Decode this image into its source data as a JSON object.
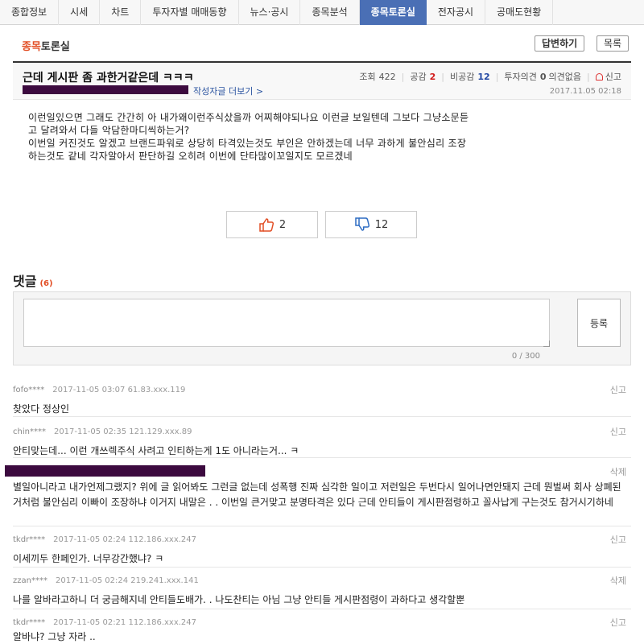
{
  "nav": {
    "tabs": [
      {
        "label": "종합정보"
      },
      {
        "label": "시세"
      },
      {
        "label": "차트"
      },
      {
        "label": "투자자별 매매동향"
      },
      {
        "label": "뉴스·공시"
      },
      {
        "label": "종목분석"
      },
      {
        "label": "종목토론실",
        "active": true
      },
      {
        "label": "전자공시"
      },
      {
        "label": "공매도현황"
      }
    ]
  },
  "board": {
    "title_accent": "종목",
    "title_rest": "토론실",
    "reply_label": "답변하기",
    "list_label": "목록"
  },
  "post": {
    "title": "근데 게시판 좀 과한거같은데 ㅋㅋㅋ",
    "views_label": "조회",
    "views": "422",
    "likes_label": "공감",
    "likes": "2",
    "dislikes_label": "비공감",
    "dislikes": "12",
    "opinion_label": "투자의견",
    "opinion_value": "0",
    "opinion_text": "의견없음",
    "report_label": "신고",
    "author_more": "작성자글 더보기 >",
    "date": "2017.11.05 02:18",
    "body": [
      "이런일있으면 그래도 간간히 아 내가왜이런주식샀을까 어찌해야되나요 이런글 보일텐데 그보다 그냥소문듣",
      "고 달려와서 다들 악담한마디씩하는거?",
      "이번일 커진것도 알겠고 브랜드파워로 상당히 타격있는것도 부인은 안하겠는데 너무 과하게 불안심리 조장",
      "하는것도 같네 각자알아서 판단하길 오히려 이번에 단타많이꼬일지도 모르겠네"
    ]
  },
  "votes": {
    "up": "2",
    "down": "12"
  },
  "comments_section": {
    "title": "댓글",
    "count": "(6)",
    "submit_label": "등록",
    "char_count": "0 / 300"
  },
  "comments": [
    {
      "nick": "fofo****",
      "meta": "2017-11-05 03:07 61.83.xxx.119",
      "action": "신고",
      "text": "찾았다 정상인"
    },
    {
      "nick": "chin****",
      "meta": "2017-11-05 02:35 121.129.xxx.89",
      "action": "신고",
      "text": "안티맞는데... 이런 개쓰렉주식 사려고 인티하는게 1도 아니라는거... ㅋ"
    },
    {
      "nick": "",
      "meta": "",
      "action": "삭제",
      "text": "별일아니라고 내가언제그랬지? 위에 글 읽어봐도 그런글 없는데 성폭행 진짜 심각한 일이고 저런일은 두번다시 일어나면안돼지 근데 뭔벌써 회사 상폐된거처럼 불안심리 이빠이 조장하냐 이거지 내말은 . . 이번일 큰거맞고 분명타격은 있다 근데 안티들이 게시판점령하고 꼴사납게 구는것도 참거시기하네"
    },
    {
      "nick": "tkdr****",
      "meta": "2017-11-05 02:24 112.186.xxx.247",
      "action": "신고",
      "text": "이세끼두 한페인가. 너무강간했냐? ㅋ"
    },
    {
      "nick": "zzan****",
      "meta": "2017-11-05 02:24 219.241.xxx.141",
      "action": "삭제",
      "text": "나를 알바라고하니 더 궁금해지네 안티들도배가. . 나도찬티는 아님 그냥 안티들 게시판점령이 과하다고 생각할뿐"
    },
    {
      "nick": "tkdr****",
      "meta": "2017-11-05 02:21 112.186.xxx.247",
      "action": "신고",
      "text": "알바냐? 그냥 자라 .."
    }
  ],
  "colors": {
    "accent": "#e24e25",
    "active_tab": "#4a6fb5",
    "redaction": "#3c0a3f"
  },
  "icons": {
    "up": "thumbs-up-icon",
    "down": "thumbs-down-icon",
    "report": "siren-icon"
  }
}
